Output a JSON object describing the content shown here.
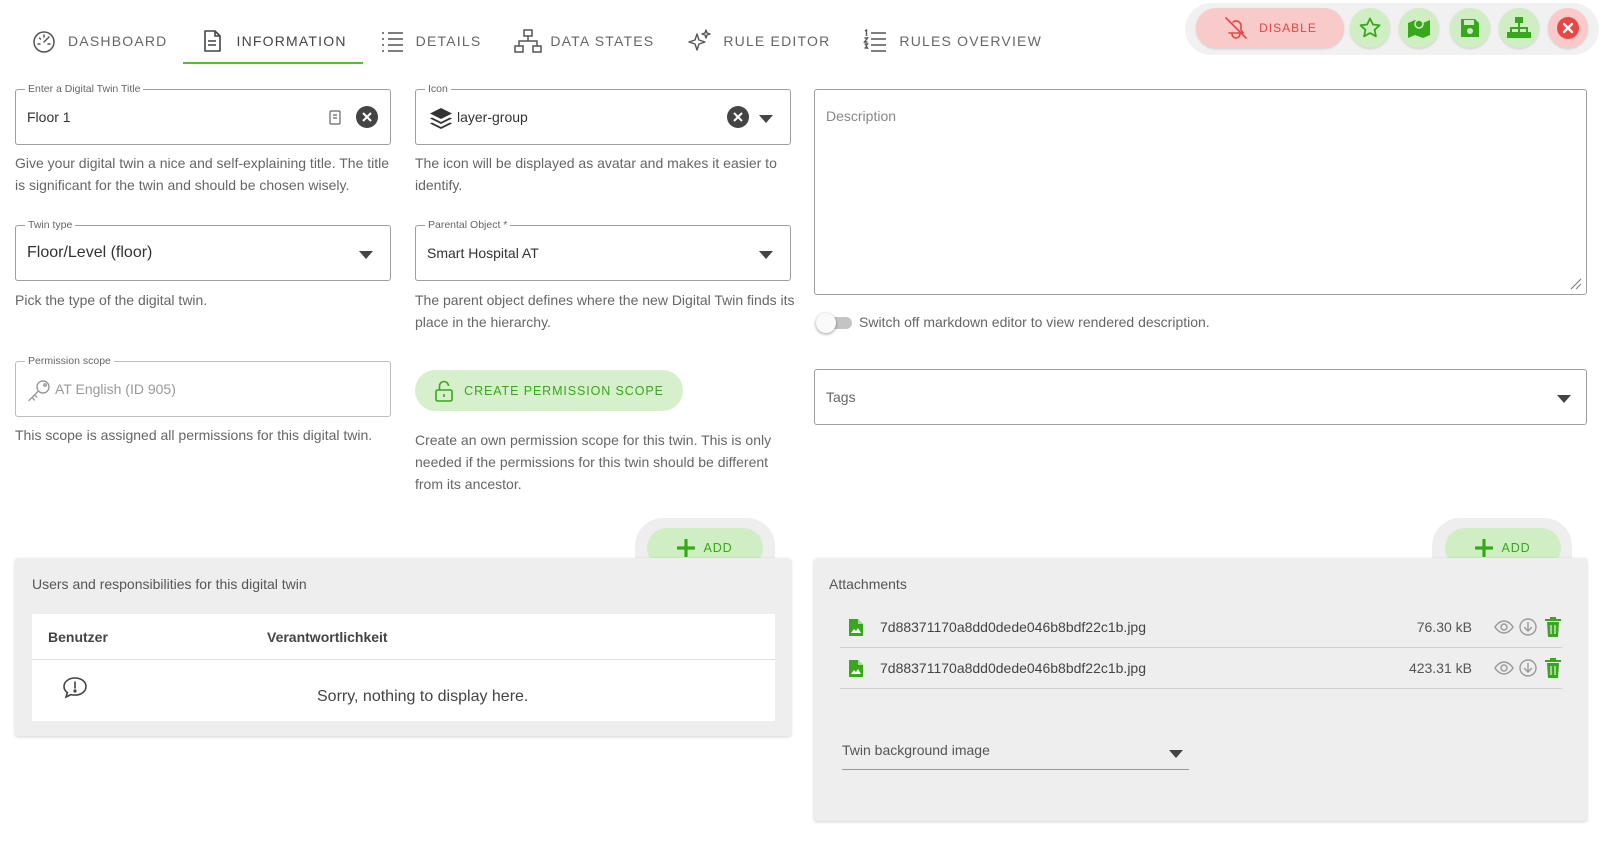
{
  "tabs": [
    {
      "label": "Dashboard",
      "icon": "dashboard-gauge-icon",
      "active": false
    },
    {
      "label": "Information",
      "icon": "document-icon",
      "active": true
    },
    {
      "label": "Details",
      "icon": "list-icon",
      "active": false
    },
    {
      "label": "Data States",
      "icon": "network-icon",
      "active": false
    },
    {
      "label": "Rule Editor",
      "icon": "sparkles-icon",
      "active": false
    },
    {
      "label": "Rules Overview",
      "icon": "numbered-list-icon",
      "active": false
    }
  ],
  "toolbar": {
    "disable_label": "Disable",
    "buttons": [
      "favorite-star-icon",
      "map-icon",
      "save-icon",
      "hierarchy-icon",
      "close-icon"
    ]
  },
  "form": {
    "title": {
      "label": "Enter a Digital Twin Title",
      "value": "Floor 1",
      "hint": "Give your digital twin a nice and self-explaining title. The title is significant for the twin and should be chosen wisely."
    },
    "icon": {
      "label": "Icon",
      "value": "layer-group",
      "hint": "The icon will be displayed as avatar and makes it easier to identify."
    },
    "twin_type": {
      "label": "Twin type",
      "value": "Floor/Level (floor)",
      "hint": "Pick the type of the digital twin."
    },
    "parent": {
      "label": "Parental Object *",
      "value": "Smart Hospital AT",
      "hint": "The parent object defines where the new Digital Twin finds its place in the hierarchy."
    },
    "permission_scope": {
      "label": "Permission scope",
      "value": "AT English (ID 905)",
      "hint": "This scope is assigned all permissions for this digital twin."
    },
    "create_scope": {
      "label": "Create permission scope",
      "hint": "Create an own permission scope for this twin. This is only needed if the permissions for this twin should be different from its ancestor."
    },
    "description": {
      "placeholder": "Description"
    },
    "markdown_toggle": {
      "label": "Switch off markdown editor to view rendered description.",
      "on": false
    },
    "tags": {
      "placeholder": "Tags"
    }
  },
  "users_panel": {
    "add_label": "Add",
    "title": "Users and responsibilities for this digital twin",
    "columns": [
      "Benutzer",
      "Verantwortlichkeit"
    ],
    "empty_text": "Sorry, nothing to display here."
  },
  "attachments_panel": {
    "add_label": "Add",
    "title": "Attachments",
    "files": [
      {
        "name": "7d88371170a8dd0dede046b8bdf22c1b.jpg",
        "size": "76.30 kB"
      },
      {
        "name": "7d88371170a8dd0dede046b8bdf22c1b.jpg",
        "size": "423.31 kB"
      }
    ],
    "background_select": {
      "placeholder": "Twin background image"
    }
  },
  "colors": {
    "accent_green": "#4cc22d",
    "danger_red": "#e84545"
  }
}
